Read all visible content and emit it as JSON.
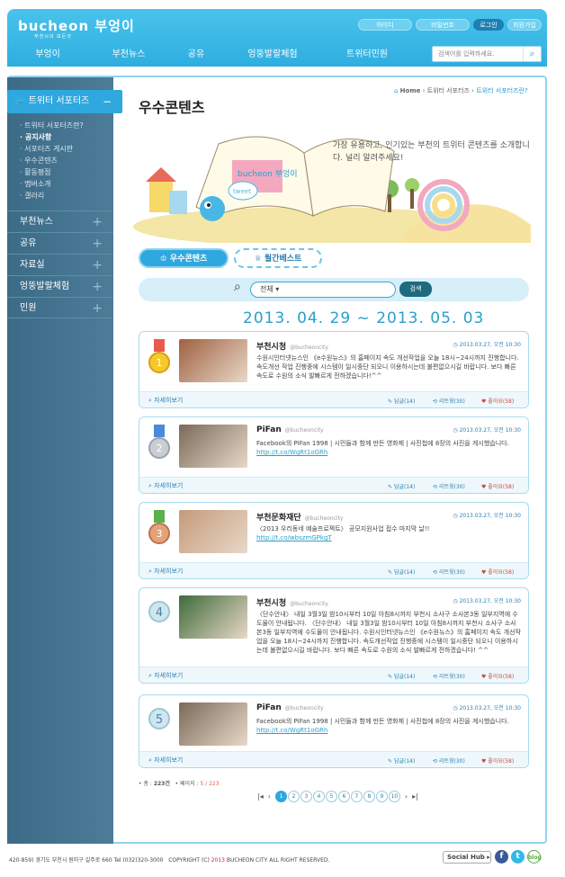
{
  "header": {
    "logo": "bucheon 부엉이",
    "logo_sub": "부천시의 모든것",
    "buttons": [
      "아이디",
      "비밀번호",
      "로그인",
      "회원가입"
    ],
    "nav": [
      "부엉이",
      "부천뉴스",
      "공유",
      "엉뚱발랄체험",
      "트위터민원"
    ],
    "search_placeholder": "검색어를 입력하세요."
  },
  "sidebar": {
    "active": "트위터 서포터즈",
    "active_toggle": "−",
    "sub": [
      "트위터 서포터즈란?",
      "공지사항",
      "서포터즈 게시판",
      "우수콘텐츠",
      "활동평점",
      "멤버소개",
      "갤러리"
    ],
    "menu": [
      "부천뉴스",
      "공유",
      "자료실",
      "엉뚱발랄체험",
      "민원"
    ],
    "menu_toggle": "+"
  },
  "page": {
    "title": "우수콘텐츠",
    "breadcrumb": [
      "Home",
      "트위터 서포터즈",
      "트위터 서포터즈란?"
    ],
    "hero_text": "가장 유용하고, 인기있는 부천의 트위터 콘텐츠를 소개합니다. 널리 알려주세요!",
    "hero_logo": "bucheon 부엉이",
    "hero_tweet": "tweet",
    "tabs": [
      "우수콘텐츠",
      "월간베스트"
    ],
    "select": "전체",
    "search_btn": "검색",
    "period": "2013. 04. 29 ~ 2013. 05. 03"
  },
  "cards": [
    {
      "rank": "1",
      "name": "부천시청",
      "handle": "@bucheoncity",
      "time": "2013.03.27,  오전 10:30",
      "body": "수원시인터넷뉴스인 《e수원뉴스》의 홈페이지 속도 개선작업을 오늘 18시~24시까지 진행합니다. 속도개선 작업 진행중에 시스템이 일시중단 되오니 이용하시는데 불편없으시길 바랍니다. 보다 빠른 속도로 수원의 소식 발빠르게 전하겠습니다!^^",
      "link": "",
      "more": "자세히보기",
      "reply": "답글(14)",
      "rt": "리트윗(30)",
      "like": "좋아요(58)"
    },
    {
      "rank": "2",
      "name": "PiFan",
      "handle": "@bucheoncity",
      "time": "2013.03.27,  오전 10:30",
      "body": "Facebook의 PiFan 1998 | 시민들과 함께 만든 영화제 | 사진첩에 8장의 사진을 게시했습니다.",
      "link": "http://t.co/WgRt1oGRh",
      "more": "자세히보기",
      "reply": "답글(14)",
      "rt": "리트윗(30)",
      "like": "좋아요(58)"
    },
    {
      "rank": "3",
      "name": "부천문화재단",
      "handle": "@bucheoncity",
      "time": "2013.03.27,  오전 10:30",
      "body": "〈2013 우리동네 예술프로젝트〉 공모지원사업 접수 마지막 날!!",
      "link": "http://t.co/wbszmGPkgT",
      "more": "자세히보기",
      "reply": "답글(14)",
      "rt": "리트윗(30)",
      "like": "좋아요(58)"
    },
    {
      "rank": "4",
      "name": "부천시청",
      "handle": "@bucheoncity",
      "time": "2013.03.27,  오전 10:30",
      "body": "〈단수안내〉 내일 3월3일 밤10시부터 10일 아침8시까지 부천시 소사구 소사본3동 일부지역에 수도물이 안내됩니다. 〈단수안내〉 내일 3월3일 밤10시부터 10일 아침8시까지 부천시 소사구 소사본3동 일부지역에 수도물이 안내됩니다. 수원시인터넷뉴스인 《e수원뉴스》의 홈페이지 속도 개선작업을 오늘 18시~24시까지 진행합니다. 속도개선작업 진행중에 시스템이 일시중단 되오니 이용하시는데 불편없으시길 바랍니다. 보다 빠른 속도로 수원의 소식 발빠르게 전하겠습니다! ^^",
      "link": "",
      "more": "자세히보기",
      "reply": "답글(14)",
      "rt": "리트윗(30)",
      "like": "좋아요(58)"
    },
    {
      "rank": "5",
      "name": "PiFan",
      "handle": "@bucheoncity",
      "time": "2013.03.27,  오전 10:30",
      "body": "Facebook의 PiFan 1998 | 시민들과 함께 만든 영화제 | 사진첩에 8장의 사진을 게시했습니다.",
      "link": "http://t.co/WgRt1oGRh",
      "more": "자세히보기",
      "reply": "답글(14)",
      "rt": "리트윗(30)",
      "like": "좋아요(58)"
    }
  ],
  "summary": {
    "total_label": "총 : ",
    "total": "223건",
    "page_label": "페이지 : ",
    "page": "5 / 223"
  },
  "pager": [
    "1",
    "2",
    "3",
    "4",
    "5",
    "6",
    "7",
    "8",
    "9",
    "10"
  ],
  "footer": {
    "address": "420-859) 경기도 부천시 원미구 길주로 660  Tel (032)320-3000",
    "copy_a": "COPYRIGHT (C) ",
    "copy_year": "2013",
    "copy_b": " BUCHEON CITY ALL RIGHT RESERVED.",
    "social": "Social Hub ▸",
    "icons": [
      "f",
      "t",
      "blog"
    ]
  },
  "colors": {
    "primary": "#2ea8de",
    "sidebar": "#46768f",
    "accent": "#2a9fcc"
  }
}
